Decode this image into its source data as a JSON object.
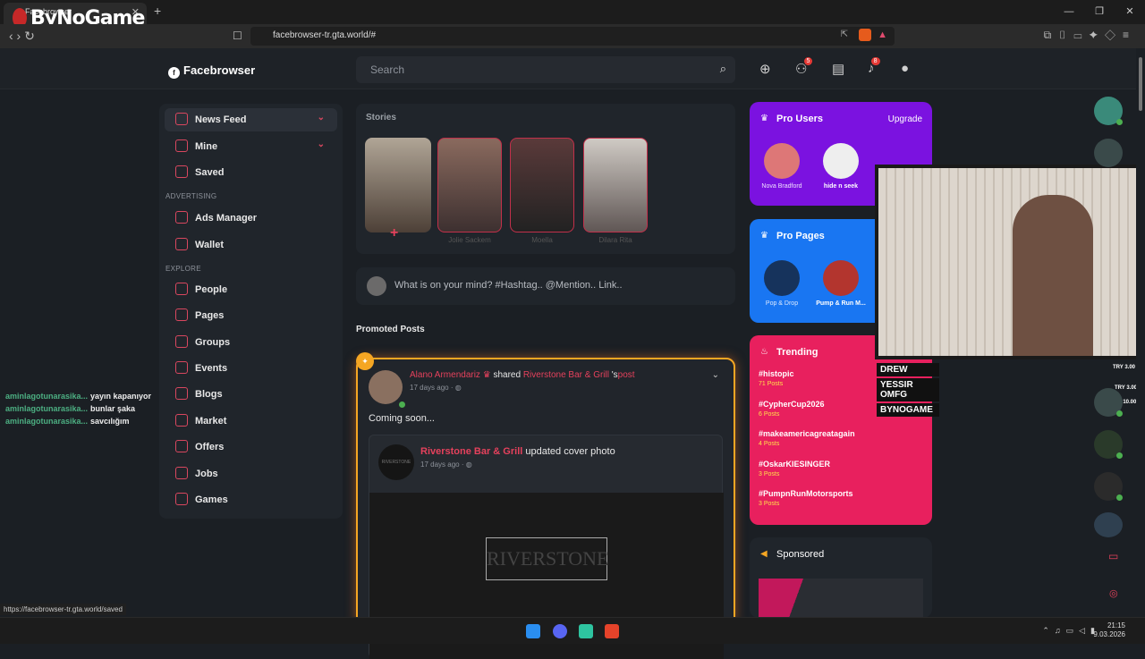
{
  "browser": {
    "tab_title": "Facebrowser",
    "tab_close": "✕",
    "new_tab": "+",
    "url": "facebrowser-tr.gta.world/#",
    "status_url": "https://facebrowser-tr.gta.world/saved"
  },
  "overlay": {
    "logo": "ByNoGame"
  },
  "app": {
    "brand": "Facebrowser",
    "search_placeholder": "Search",
    "friend_badge": "5",
    "notif_badge": "8"
  },
  "sidebar": {
    "items": [
      {
        "label": "News Feed"
      },
      {
        "label": "Mine"
      },
      {
        "label": "Saved"
      }
    ],
    "advertising_title": "ADVERTISING",
    "advertising": [
      {
        "label": "Ads Manager"
      },
      {
        "label": "Wallet"
      }
    ],
    "explore_title": "EXPLORE",
    "explore": [
      {
        "label": "People"
      },
      {
        "label": "Pages"
      },
      {
        "label": "Groups"
      },
      {
        "label": "Events"
      },
      {
        "label": "Blogs"
      },
      {
        "label": "Market"
      },
      {
        "label": "Offers"
      },
      {
        "label": "Jobs"
      },
      {
        "label": "Games"
      }
    ]
  },
  "stories": {
    "title": "Stories",
    "names": [
      "Jolie Sackem",
      "Moella",
      "Dilara Rita"
    ]
  },
  "composer": {
    "placeholder": "What is on your mind? #Hashtag.. @Mention.. Link.."
  },
  "promoted": {
    "title": "Promoted Posts",
    "author": "Alano Armendariz",
    "shared": "shared",
    "page": "Riverstone Bar & Grill",
    "possessive": "'s",
    "post_word": "post",
    "time": "17 days ago ·",
    "body": "Coming soon...",
    "inner_author": "Riverstone Bar & Grill",
    "inner_action": "updated cover photo",
    "inner_time": "17 days ago ·",
    "logo_text": "RIVERSTONE"
  },
  "right": {
    "pro_users_title": "Pro Users",
    "upgrade": "Upgrade",
    "pro_users": [
      {
        "name": "Nova Bradford"
      },
      {
        "name": "hide n seek"
      }
    ],
    "pro_pages_title": "Pro Pages",
    "pro_pages": [
      {
        "name": "Pop & Drop"
      },
      {
        "name": "Pump & Run M..."
      }
    ],
    "trending_title": "Trending",
    "trending": [
      {
        "tag": "#histopic",
        "count": "71 Posts"
      },
      {
        "tag": "#CypherCup2026",
        "count": "6 Posts"
      },
      {
        "tag": "#makeamericagreatagain",
        "count": "4 Posts"
      },
      {
        "tag": "#OskarKIESINGER",
        "count": "3 Posts"
      },
      {
        "tag": "#PumpnRunMotorsports",
        "count": "3 Posts"
      }
    ],
    "sponsored_title": "Sponsored"
  },
  "stream": {
    "labels": [
      "DREW",
      "YESSIR OMFG",
      "BYNOGAME"
    ],
    "try1": "TRY 3.00",
    "try2": "TRY 3.00",
    "try3": "TRY 10.00"
  },
  "chat": [
    {
      "user": "aminlagotunarasika...",
      "msg": "yayın kapanıyor"
    },
    {
      "user": "aminlagotunarasika...",
      "msg": "bunlar şaka"
    },
    {
      "user": "aminlagotunarasika...",
      "msg": "savcılığım"
    }
  ],
  "clock": {
    "time": "21:15",
    "date": "9.03.2026"
  }
}
